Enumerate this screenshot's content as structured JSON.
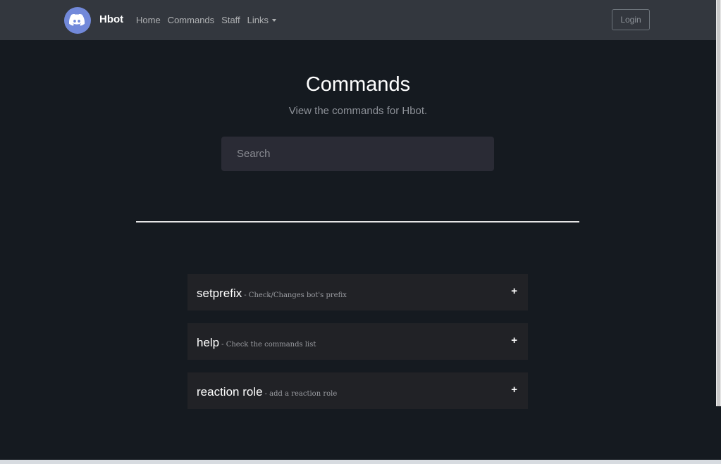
{
  "navbar": {
    "brand": "Hbot",
    "links": [
      "Home",
      "Commands",
      "Staff"
    ],
    "dropdown_label": "Links",
    "login_label": "Login"
  },
  "header": {
    "title": "Commands",
    "subtitle": "View the commands for Hbot."
  },
  "search": {
    "placeholder": "Search",
    "value": ""
  },
  "commands": [
    {
      "name": "setprefix",
      "desc": "- Check/Changes bot's prefix",
      "toggle": "+"
    },
    {
      "name": "help",
      "desc": "- Check the commands list",
      "toggle": "+"
    },
    {
      "name": "reaction role",
      "desc": "- add a reaction role",
      "toggle": "+"
    }
  ],
  "colors": {
    "navbar_bg": "#33373e",
    "page_bg": "#151a20",
    "brand_accent": "#7289da",
    "row_bg": "#212226"
  },
  "icons": {
    "logo": "discord-logo-icon",
    "dropdown": "caret-down-icon",
    "expand": "plus-icon"
  }
}
